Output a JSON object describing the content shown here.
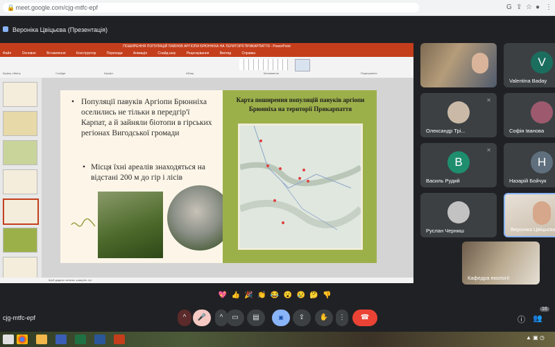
{
  "browser": {
    "url": "meet.google.com/cjg-mtfc-epf",
    "icons": [
      "google-g-icon",
      "share-icon",
      "star-icon",
      "profile-icon",
      "menu-icon"
    ]
  },
  "meet": {
    "presenter_label": "Вероніка Цвіцьєва (Презентація)",
    "meeting_code": "cjg-mtfc-epf",
    "reactions": [
      "💖",
      "👍",
      "🎉",
      "👏",
      "😂",
      "😮",
      "😢",
      "🤔",
      "👎"
    ],
    "participant_count": "16"
  },
  "ppt": {
    "title_text": "ПОШИРЕННЯ ПОПУЛЯЦІЙ ПАВУКІВ АРГІОПИ БРЮННІХА НА ТЕРИТОРІЇ ПРИКАРПАТТЯ - PowerPoint",
    "tabs": [
      "Файл",
      "Основне",
      "Вставлення",
      "Конструктор",
      "Переходи",
      "Анімація",
      "Слайд-шоу",
      "Рецензування",
      "Вигляд",
      "Справка"
    ],
    "ribbon_groups": [
      "Буфер обміну",
      "Слайди",
      "Шрифт",
      "Абзац",
      "Малювання",
      "Редагування"
    ],
    "status_text": "Щоб додати нотатки, клацніть тут"
  },
  "slide": {
    "bullet1": "Популяції павуків Аргіопи Брюнніха оселились не тільки в передгір'ї Карпат, а й зайняли біотопи в гірських регіонах Вигодської громади",
    "bullet2": "Місця їхні ареалів знаходяться на відстані 200 м до гір і лісів",
    "map_title": "Карта поширення популяцій павуків аргіопи Брюнніха на території Прикарпаття"
  },
  "participants": [
    {
      "name": "",
      "kind": "video"
    },
    {
      "name": "Valentina Baday",
      "initial": "V",
      "color": "#1b6e5e"
    },
    {
      "name": "Олександр Трі...",
      "kind": "photo"
    },
    {
      "name": "Софія Іванова",
      "kind": "photo"
    },
    {
      "name": "Василь Рудий",
      "initial": "В",
      "color": "#1e8e6e"
    },
    {
      "name": "Назарій Бойчук",
      "initial": "Н",
      "color": "#5f6f7d"
    },
    {
      "name": "Руслан Черниш",
      "kind": "photo"
    },
    {
      "name": "Вероніка Цвіцьєва",
      "kind": "video"
    },
    {
      "name": "Кафедра екології",
      "kind": "video"
    }
  ]
}
